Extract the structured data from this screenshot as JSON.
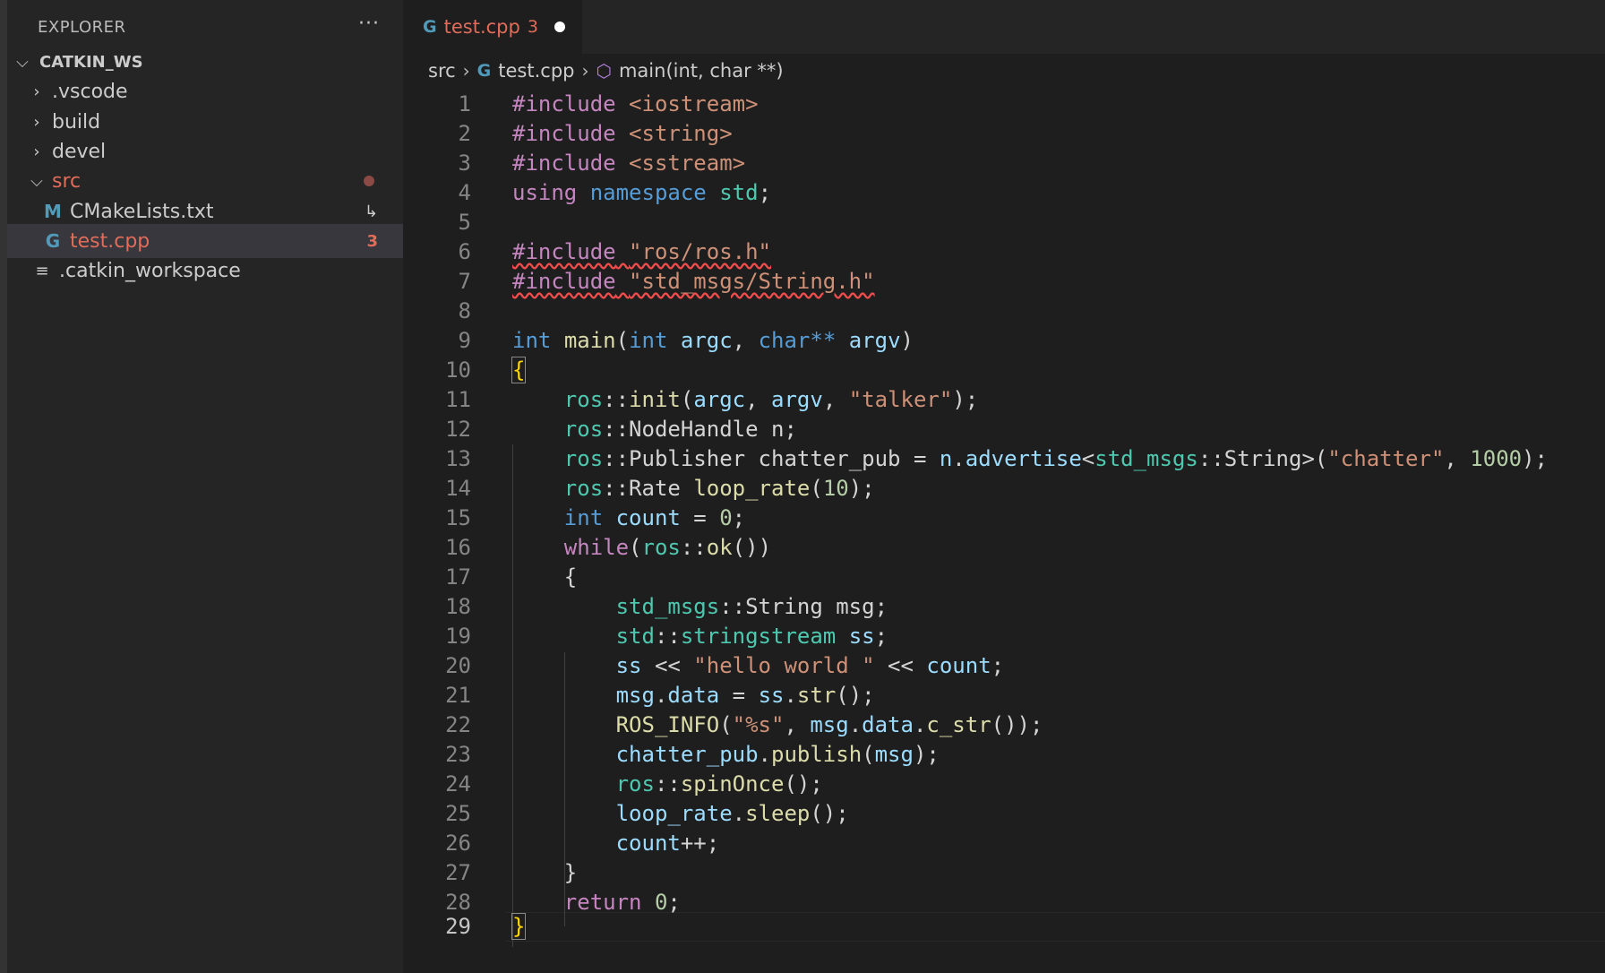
{
  "sidebar": {
    "title": "EXPLORER",
    "more_label": "···",
    "root": "CATKIN_WS",
    "items": [
      {
        "label": ".vscode"
      },
      {
        "label": "build"
      },
      {
        "label": "devel"
      },
      {
        "label": "src"
      },
      {
        "label": "CMakeLists.txt",
        "icon_text": "M",
        "badge": "↳"
      },
      {
        "label": "test.cpp",
        "icon_text": "G",
        "badge": "3"
      },
      {
        "label": ".catkin_workspace"
      }
    ]
  },
  "tab": {
    "label": "test.cpp",
    "count": "3"
  },
  "breadcrumb": {
    "src": "src",
    "file": "test.cpp",
    "symbol": "main(int, char **)"
  },
  "editor": {
    "line_numbers": [
      "1",
      "2",
      "3",
      "4",
      "5",
      "6",
      "7",
      "8",
      "9",
      "10",
      "11",
      "12",
      "13",
      "14",
      "15",
      "16",
      "17",
      "18",
      "19",
      "20",
      "21",
      "22",
      "23",
      "24",
      "25",
      "26",
      "27",
      "28",
      "29"
    ],
    "current_line": 29
  },
  "colors": {
    "keyword": "#569cd6",
    "control": "#c586c0",
    "type": "#4ec9b0",
    "function": "#dcdcaa",
    "variable": "#9cdcfe",
    "string": "#ce9178",
    "number": "#b5cea8",
    "modified": "#e06c5a"
  }
}
